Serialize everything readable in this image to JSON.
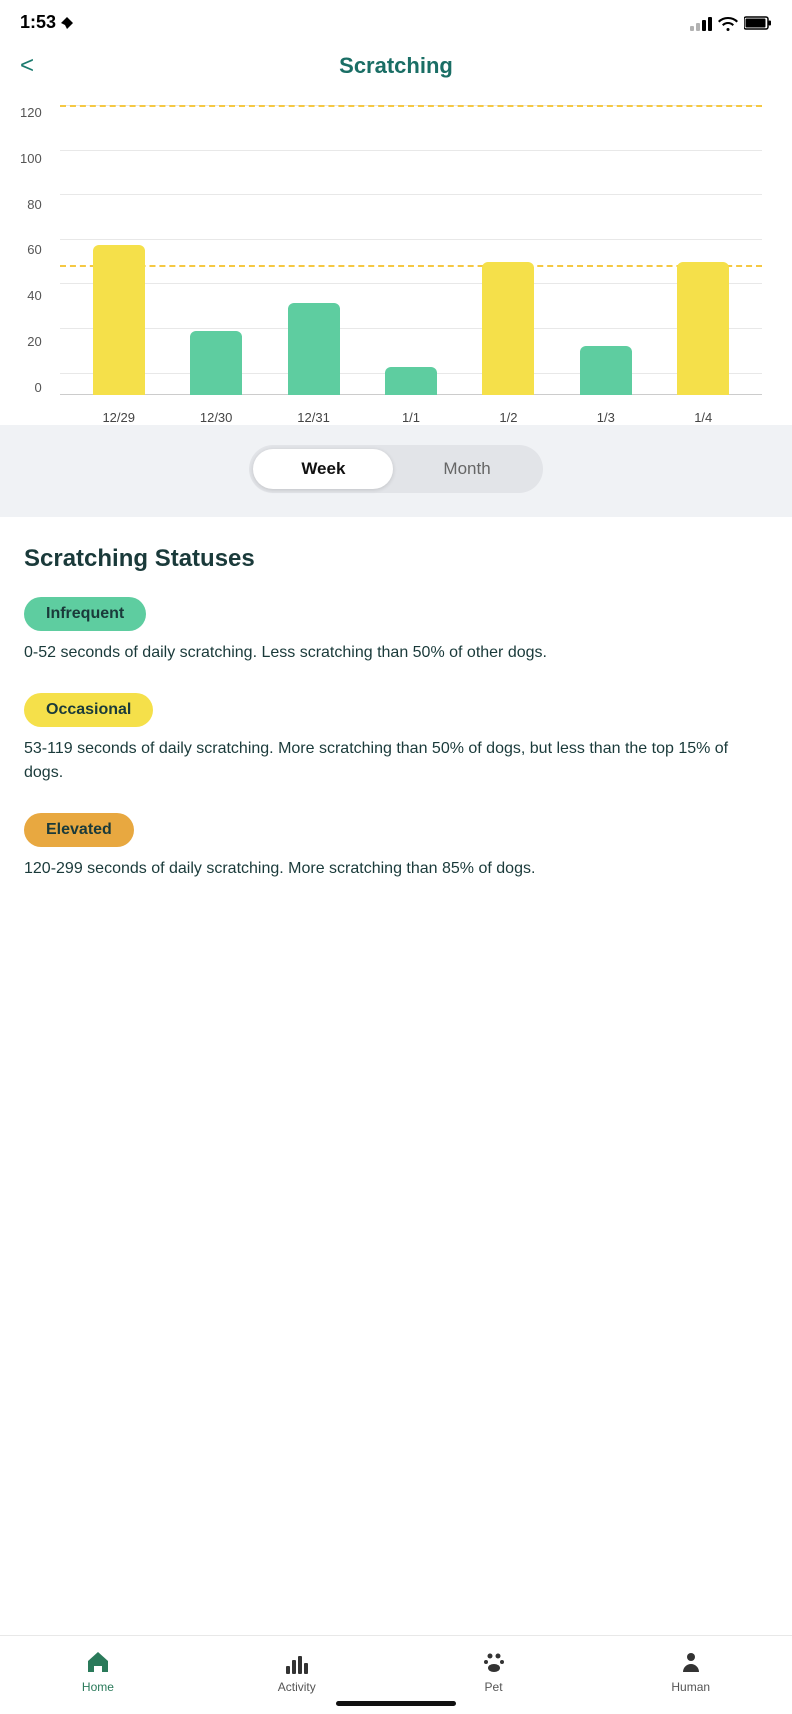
{
  "statusBar": {
    "time": "1:53",
    "hasLocation": true
  },
  "header": {
    "backLabel": "<",
    "title": "Scratching"
  },
  "chart": {
    "yLabels": [
      "120",
      "100",
      "80",
      "60",
      "40",
      "20",
      "0"
    ],
    "xLabels": [
      "12/29",
      "12/30",
      "12/31",
      "1/1",
      "1/2",
      "1/3",
      "1/4"
    ],
    "bars": [
      {
        "value": 70,
        "color": "yellow"
      },
      {
        "value": 30,
        "color": "green"
      },
      {
        "value": 43,
        "color": "green"
      },
      {
        "value": 13,
        "color": "green"
      },
      {
        "value": 62,
        "color": "yellow"
      },
      {
        "value": 23,
        "color": "green"
      },
      {
        "value": 62,
        "color": "yellow"
      }
    ],
    "maxValue": 130,
    "refLine1": 120,
    "refLine2": 55
  },
  "toggle": {
    "weekLabel": "Week",
    "monthLabel": "Month",
    "activeTab": "week"
  },
  "statuses": {
    "title": "Scratching Statuses",
    "items": [
      {
        "badge": "Infrequent",
        "badgeColor": "green",
        "description": "0-52 seconds of daily scratching. Less scratching than 50% of other dogs."
      },
      {
        "badge": "Occasional",
        "badgeColor": "yellow",
        "description": "53-119 seconds of daily scratching. More scratching than 50% of dogs, but less than the top 15% of dogs."
      },
      {
        "badge": "Elevated",
        "badgeColor": "orange",
        "description": "120-299 seconds of daily scratching. More scratching than 85% of dogs."
      }
    ]
  },
  "bottomNav": {
    "items": [
      {
        "label": "Home",
        "icon": "home-icon",
        "active": true
      },
      {
        "label": "Activity",
        "icon": "activity-icon",
        "active": false
      },
      {
        "label": "Pet",
        "icon": "pet-icon",
        "active": false
      },
      {
        "label": "Human",
        "icon": "human-icon",
        "active": false
      }
    ]
  }
}
